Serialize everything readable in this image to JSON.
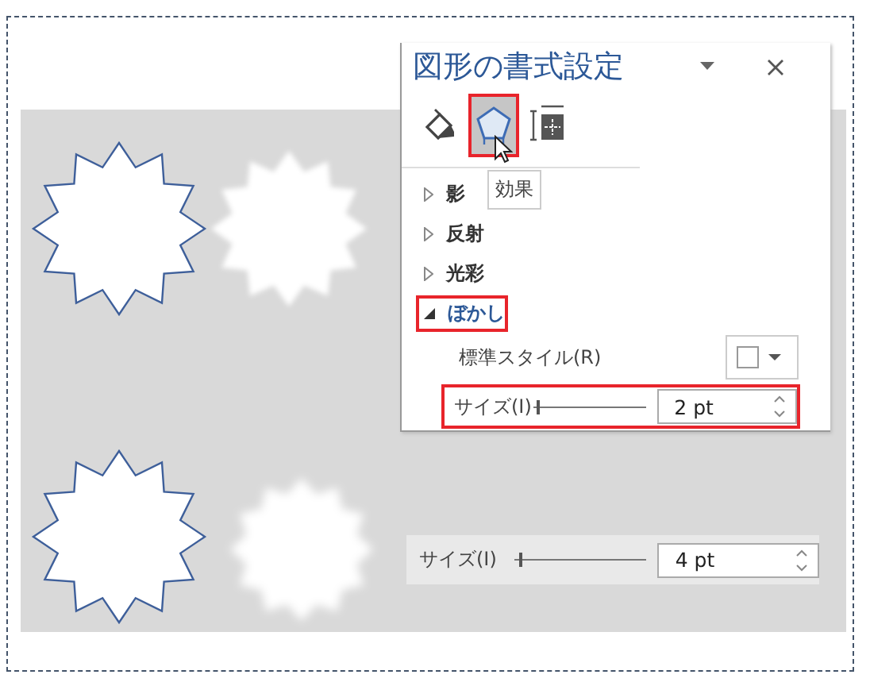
{
  "panel": {
    "title": "図形の書式設定",
    "tabs": [
      {
        "kind": "fill",
        "selected": false,
        "highlighted": false
      },
      {
        "kind": "effects",
        "selected": true,
        "highlighted": true
      },
      {
        "kind": "size",
        "selected": false,
        "highlighted": false
      }
    ],
    "tooltip": "効果",
    "sections": [
      {
        "label": "影",
        "expanded": false,
        "highlighted": false
      },
      {
        "label": "反射",
        "expanded": false,
        "highlighted": false
      },
      {
        "label": "光彩",
        "expanded": false,
        "highlighted": false
      },
      {
        "label": "ぼかし",
        "expanded": true,
        "highlighted": true
      }
    ],
    "preset_label": "標準スタイル(R)",
    "size": {
      "label": "サイズ(I)",
      "level": 0.02,
      "value": "2 pt",
      "highlighted": true
    }
  },
  "size_row": {
    "label": "サイズ(I)",
    "level": 0.04,
    "value": "4 pt"
  }
}
